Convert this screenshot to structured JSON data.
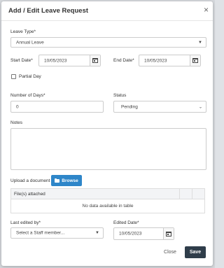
{
  "modal": {
    "title": "Add / Edit Leave Request",
    "close_symbol": "×"
  },
  "leave_type": {
    "label": "Leave Type*",
    "value": "Annual Leave"
  },
  "start_date": {
    "label": "Start Date*",
    "value": "10/05/2023"
  },
  "end_date": {
    "label": "End Date*",
    "value": "10/05/2023"
  },
  "partial_day": {
    "label": "Partial Day",
    "checked": false
  },
  "number_of_days": {
    "label": "Number of Days*",
    "value": "0"
  },
  "status": {
    "label": "Status",
    "value": "Pending"
  },
  "notes": {
    "label": "Notes",
    "value": ""
  },
  "upload": {
    "label": "Upload a document",
    "button_label": "Browse"
  },
  "files_table": {
    "header": "File(s) attached",
    "empty_text": "No data available in table"
  },
  "last_edited_by": {
    "label": "Last edited by*",
    "placeholder": "Select a Staff member..."
  },
  "edited_date": {
    "label": "Edited Date*",
    "value": "10/05/2023"
  },
  "footer": {
    "close_label": "Close",
    "save_label": "Save"
  },
  "colors": {
    "primary": "#2e86c9",
    "save": "#2f3d4a"
  }
}
